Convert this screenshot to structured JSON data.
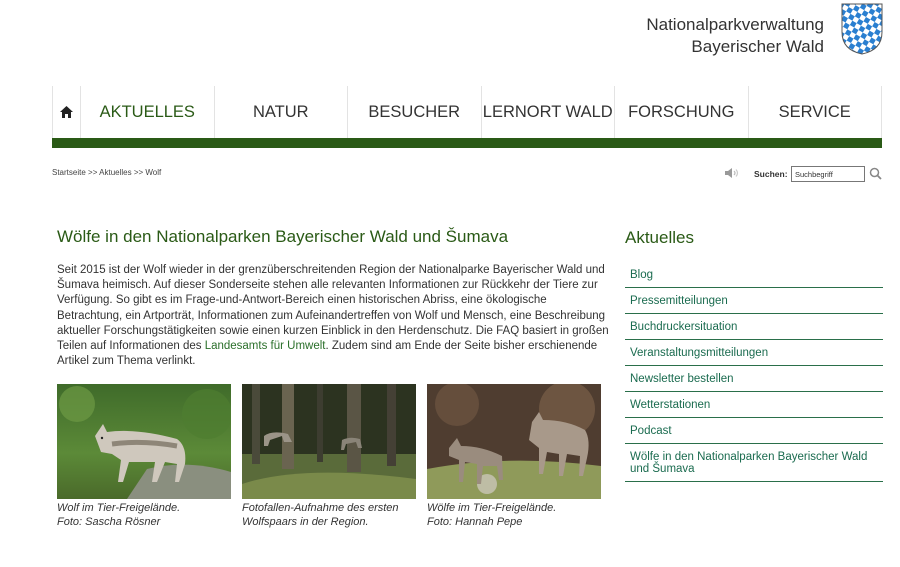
{
  "header": {
    "org_line1": "Nationalparkverwaltung",
    "org_line2": "Bayerischer Wald"
  },
  "nav": {
    "home_icon": "home-icon",
    "items": [
      "AKTUELLES",
      "NATUR",
      "BESUCHER",
      "LERNORT WALD",
      "FORSCHUNG",
      "SERVICE"
    ],
    "active": "AKTUELLES"
  },
  "breadcrumb": "Startseite >> Aktuelles >> Wolf",
  "search": {
    "label": "Suchen:",
    "placeholder": "Suchbegriff"
  },
  "main": {
    "title": "Wölfe in den Nationalparken Bayerischer Wald und Šumava",
    "intro_before": "Seit 2015 ist der Wolf wieder in der grenzüberschreitenden Region der Nationalparke Bayerischer Wald und Šumava heimisch. Auf dieser Sonderseite stehen alle relevanten Informationen zur Rückkehr der Tiere zur Verfügung. So gibt es im Frage-und-Antwort-Bereich einen historischen Abriss, eine ökologische Betrachtung, ein Artporträt, Informationen zum Aufeinandertreffen von Wolf und Mensch, eine Beschreibung aktueller Forschungstätigkeiten sowie einen kurzen Einblick in den Herdenschutz. Die FAQ basiert in großen Teilen auf Informationen des ",
    "intro_link": "Landesamts für Umwelt",
    "intro_after": ". Zudem sind am Ende der Seite bisher erschienende Artikel zum Thema verlinkt.",
    "photos": [
      {
        "line1": "Wolf im Tier-Freigelände.",
        "line2": "Foto: Sascha Rösner"
      },
      {
        "line1": "Fotofallen-Aufnahme des ersten",
        "line2": "Wolfspaars in der Region."
      },
      {
        "line1": "Wölfe im Tier-Freigelände.",
        "line2": "Foto: Hannah Pepe"
      }
    ]
  },
  "sidebar": {
    "title": "Aktuelles",
    "items": [
      "Blog",
      "Pressemitteilungen",
      "Buchdruckersituation",
      "Veranstaltungsmitteilungen",
      "Newsletter bestellen",
      "Wetterstationen",
      "Podcast",
      "Wölfe in den Nationalparken Bayerischer Wald und Šumava"
    ]
  },
  "colors": {
    "brand_green": "#2a5a16",
    "link_green": "#1a6b4f"
  }
}
